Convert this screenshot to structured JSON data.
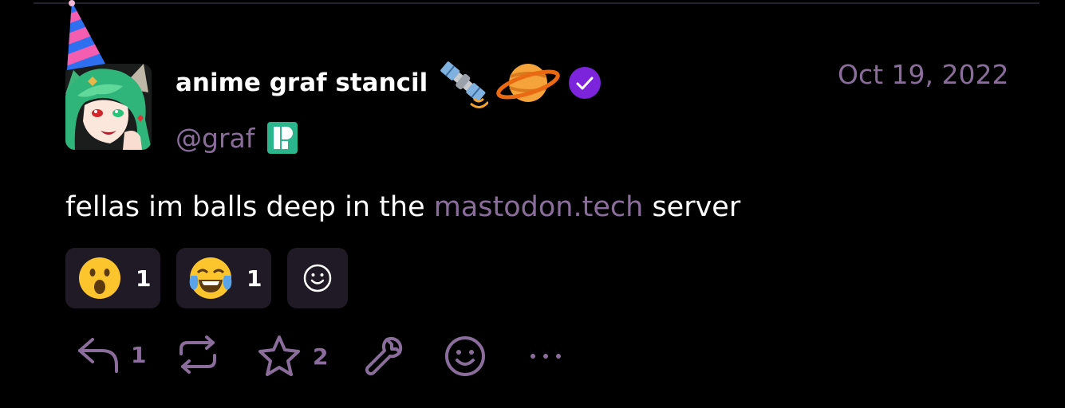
{
  "post": {
    "author": {
      "display_name": "anime graf stancil",
      "handle": "@graf",
      "name_emojis": [
        "satellite-emoji",
        "ringed-planet-emoji"
      ],
      "verified": true,
      "instance_icon": "pleroma-icon"
    },
    "date": "Oct 19, 2022",
    "text_before": "fellas im balls deep in the ",
    "link_text": "mastodon.tech",
    "text_after": " server",
    "reactions": [
      {
        "emoji": "face-with-open-mouth",
        "count": "1"
      },
      {
        "emoji": "face-with-tears-of-joy",
        "count": "1"
      }
    ],
    "add_reaction_icon": "smiley-icon",
    "actions": {
      "reply_count": "1",
      "favorite_count": "2",
      "icons": [
        "reply-icon",
        "repeat-icon",
        "star-icon",
        "wrench-icon",
        "smiley-icon",
        "more-icon"
      ]
    }
  },
  "colors": {
    "background": "#000000",
    "muted": "#8b6d9c",
    "reaction_bg": "#201a27",
    "verified": "#7b24db",
    "text": "#ffffff"
  }
}
